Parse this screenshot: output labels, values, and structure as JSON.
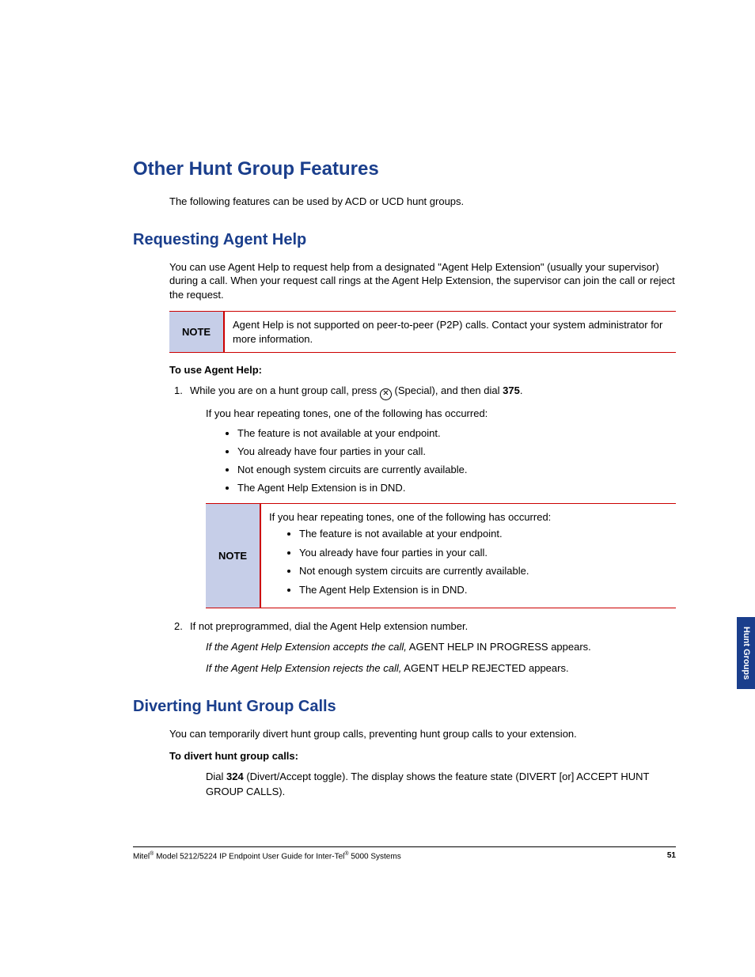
{
  "h1": "Other Hunt Group Features",
  "p_intro": "The following features can be used by ACD or UCD hunt groups.",
  "h2_a": "Requesting Agent Help",
  "p_a1": "You can use Agent Help to request help from a designated \"Agent Help Extension\" (usually your supervisor) during a call. When your request call rings at the Agent Help Extension, the supervisor can join the call or reject the request.",
  "note1_label": "NOTE",
  "note1_body": "Agent Help is not supported on peer-to-peer (P2P) calls. Contact your system administrator for more information.",
  "sub_a": "To use Agent Help:",
  "step1_num": "1.",
  "step1_a": "While you are on a hunt group call, press ",
  "step1_b": " (Special), and then dial ",
  "step1_code": "375",
  "step1_c": ".",
  "step1_sub": "If you hear repeating tones, one of the following has occurred:",
  "bullets": [
    "The feature is not available at your endpoint.",
    "You already have four parties in your call.",
    "Not enough system circuits are currently available.",
    "The Agent Help Extension is in DND."
  ],
  "note2_label": "NOTE",
  "note2_intro": "If you hear repeating tones, one of the following has occurred:",
  "note2_bullets": [
    "The feature is not available at your endpoint.",
    "You already have four parties in your call.",
    "Not enough system circuits are currently available.",
    "The Agent Help Extension is in DND."
  ],
  "step2_num": "2.",
  "step2_a": "If not preprogrammed, dial the Agent Help extension number.",
  "step2_b_i": "If the Agent Help Extension accepts the call,",
  "step2_b_r": " AGENT HELP IN PROGRESS appears.",
  "step2_c_i": "If the Agent Help Extension rejects the call,",
  "step2_c_r": " AGENT HELP REJECTED appears.",
  "h2_b": "Diverting Hunt Group Calls",
  "p_b1": "You can temporarily divert hunt group calls, preventing hunt group calls to your extension.",
  "sub_b": "To divert hunt group calls:",
  "divert_a": "Dial ",
  "divert_code": "324",
  "divert_b": " (Divert/Accept toggle). The display shows the feature state (DIVERT [or] ACCEPT HUNT GROUP CALLS).",
  "tab": "Hunt\nGroups",
  "footer_left_a": "Mitel",
  "footer_left_b": " Model 5212/5224 IP Endpoint User Guide for Inter-Tel",
  "footer_left_c": " 5000 Systems",
  "page_num": "51",
  "special_glyph": "✕"
}
